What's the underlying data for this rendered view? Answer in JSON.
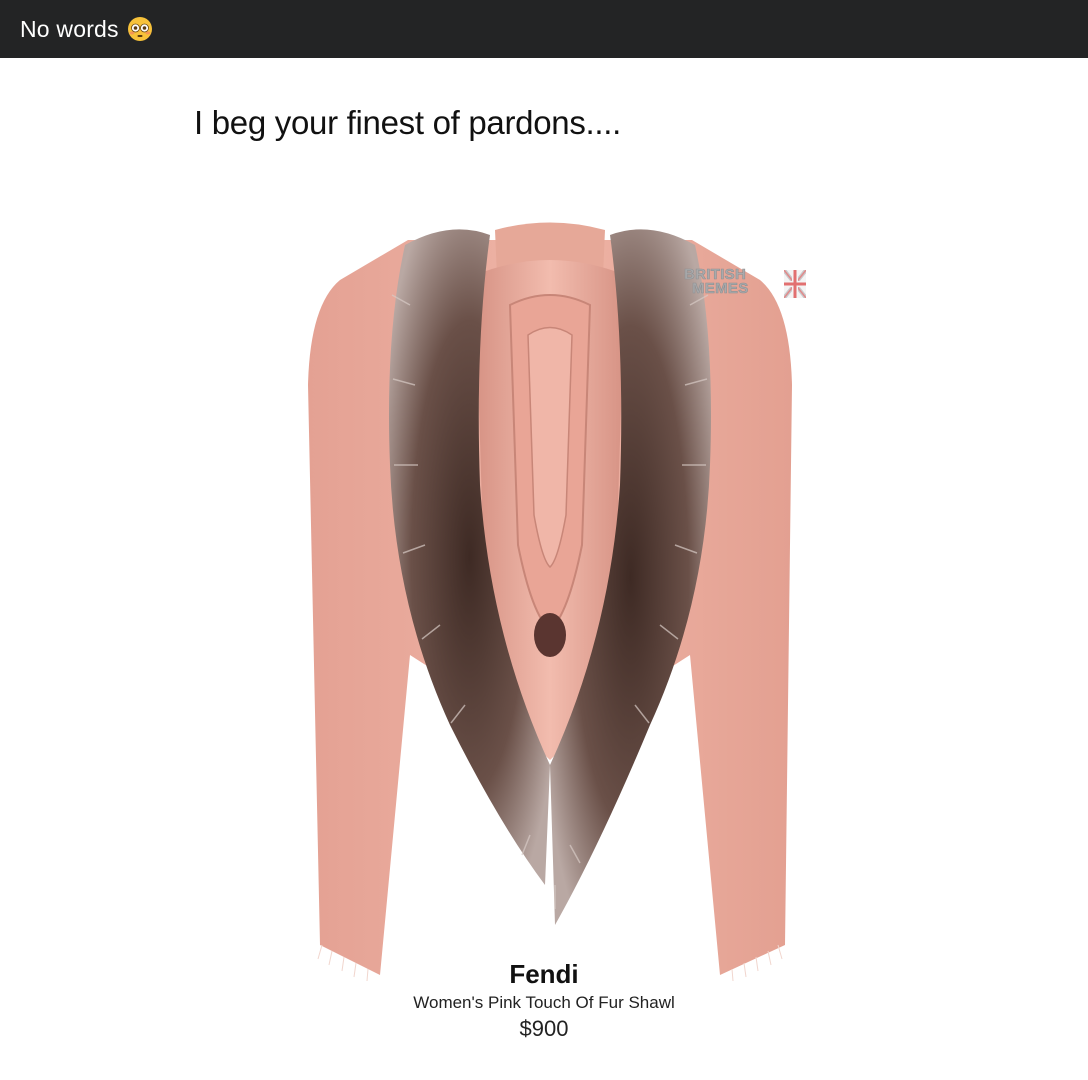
{
  "post": {
    "title": "No words",
    "emoji_icon": "flushed-face-icon",
    "caption": "I beg your finest of pardons...."
  },
  "image": {
    "watermark": {
      "line1": "BRITISH",
      "line2": "MEMES"
    },
    "product": {
      "brand": "Fendi",
      "name": "Women's Pink Touch Of Fur Shawl",
      "price": "$900"
    }
  },
  "colors": {
    "topbar": "#232425",
    "shawl_pink": "#e8a89a",
    "fur_brown": "#5a4038"
  }
}
